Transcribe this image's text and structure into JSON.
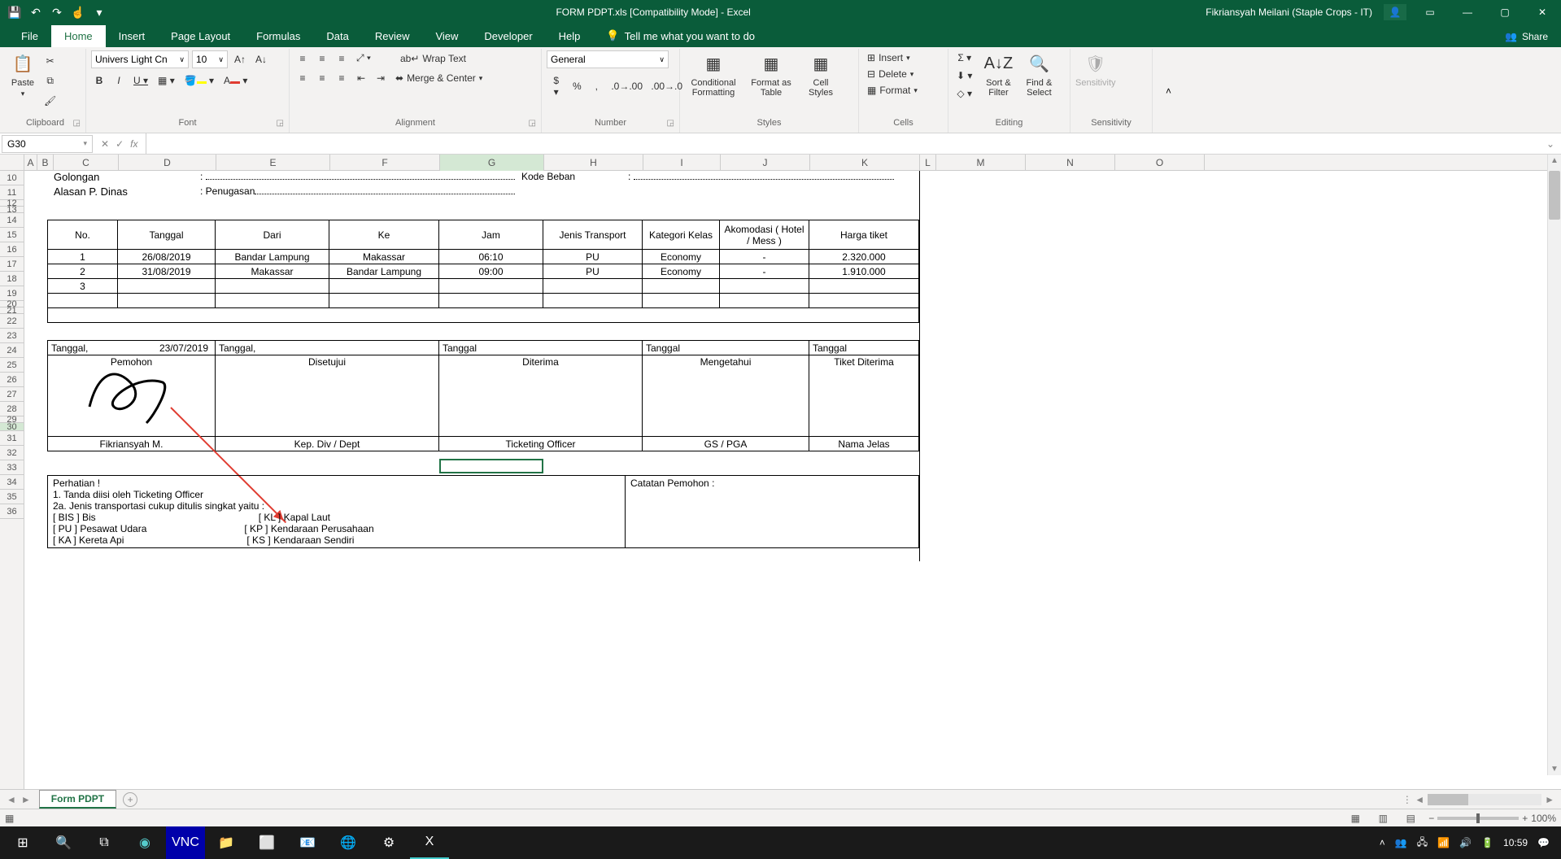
{
  "title": "FORM PDPT.xls  [Compatibility Mode]  -  Excel",
  "user": "Fikriansyah Meilani (Staple Crops - IT)",
  "tabs": [
    "File",
    "Home",
    "Insert",
    "Page Layout",
    "Formulas",
    "Data",
    "Review",
    "View",
    "Developer",
    "Help"
  ],
  "tell": "Tell me what you want to do",
  "share": "Share",
  "font": {
    "name": "Univers Light Cn",
    "size": "10"
  },
  "numberformat": "General",
  "ribbon": {
    "paste": "Paste",
    "clipboard": "Clipboard",
    "font": "Font",
    "alignment": "Alignment",
    "number": "Number",
    "styles": "Styles",
    "cells": "Cells",
    "editing": "Editing",
    "sensitivity": "Sensitivity",
    "wrap": "Wrap Text",
    "merge": "Merge & Center",
    "cond": "Conditional Formatting",
    "fmtas": "Format as Table",
    "cellstyles": "Cell Styles",
    "insert": "Insert",
    "delete": "Delete",
    "format": "Format",
    "sortfilter": "Sort & Filter",
    "findselect": "Find & Select",
    "sens": "Sensitivity"
  },
  "namebox": "G30",
  "columns": [
    "A",
    "B",
    "C",
    "D",
    "E",
    "F",
    "G",
    "H",
    "I",
    "J",
    "K",
    "L",
    "M",
    "N",
    "O"
  ],
  "rows": [
    "10",
    "11",
    "12",
    "13",
    "14",
    "15",
    "16",
    "17",
    "18",
    "19",
    "20",
    "21",
    "22",
    "23",
    "24",
    "25",
    "26",
    "27",
    "28",
    "29",
    "30",
    "31",
    "32",
    "33",
    "34",
    "35",
    "36"
  ],
  "sheet": {
    "name": "Form PDPT"
  },
  "status": {
    "zoom": "100%",
    "time": "10:59"
  },
  "form": {
    "golongan": "Golongan",
    "kode": "Kode Beban",
    "alasan_label": "Alasan P. Dinas",
    "alasan_val": "Penugasan",
    "headers": {
      "no": "No.",
      "tanggal": "Tanggal",
      "dari": "Dari",
      "ke": "Ke",
      "jam": "Jam",
      "jenis": "Jenis Transport",
      "kategori": "Kategori Kelas",
      "akomodasi": "Akomodasi ( Hotel / Mess )",
      "harga": "Harga tiket"
    },
    "data": [
      {
        "no": "1",
        "tgl": "26/08/2019",
        "dari": "Bandar Lampung",
        "ke": "Makassar",
        "jam": "06:10",
        "jenis": "PU",
        "kat": "Economy",
        "ako": "-",
        "harga": "2.320.000"
      },
      {
        "no": "2",
        "tgl": "31/08/2019",
        "dari": "Makassar",
        "ke": "Bandar Lampung",
        "jam": "09:00",
        "jenis": "PU",
        "kat": "Economy",
        "ako": "-",
        "harga": "1.910.000"
      },
      {
        "no": "3",
        "tgl": "",
        "dari": "",
        "ke": "",
        "jam": "",
        "jenis": "",
        "kat": "",
        "ako": "",
        "harga": ""
      }
    ],
    "sig": {
      "tgl": "Tanggal,",
      "date": "23/07/2019",
      "pemohon": "Pemohon",
      "disetujui": "Disetujui",
      "diterima": "Diterima",
      "mengetahui": "Mengetahui",
      "tiketditerima": "Tiket Diterima",
      "name": "Fikriansyah M.",
      "kep": "Kep. Div / Dept",
      "ticketing": "Ticketing Officer",
      "gs": "GS / PGA",
      "nama": "Nama Jelas",
      "tanggal": "Tanggal"
    },
    "notes": {
      "perhatian": "Perhatian !",
      "l1": "1. Tanda  diisi oleh Ticketing Officer",
      "l2": "2a. Jenis transportasi cukup ditulis singkat yaitu :",
      "bis": "[ BIS ]    Bis",
      "pu": "[ PU ]    Pesawat Udara",
      "ka": "[ KA ]    Kereta Api",
      "kl": "[ KL ]    Kapal Laut",
      "kp": "[ KP ]    Kendaraan Perusahaan",
      "ks": "[ KS ]    Kendaraan Sendiri",
      "catatan": "Catatan Pemohon :"
    }
  }
}
